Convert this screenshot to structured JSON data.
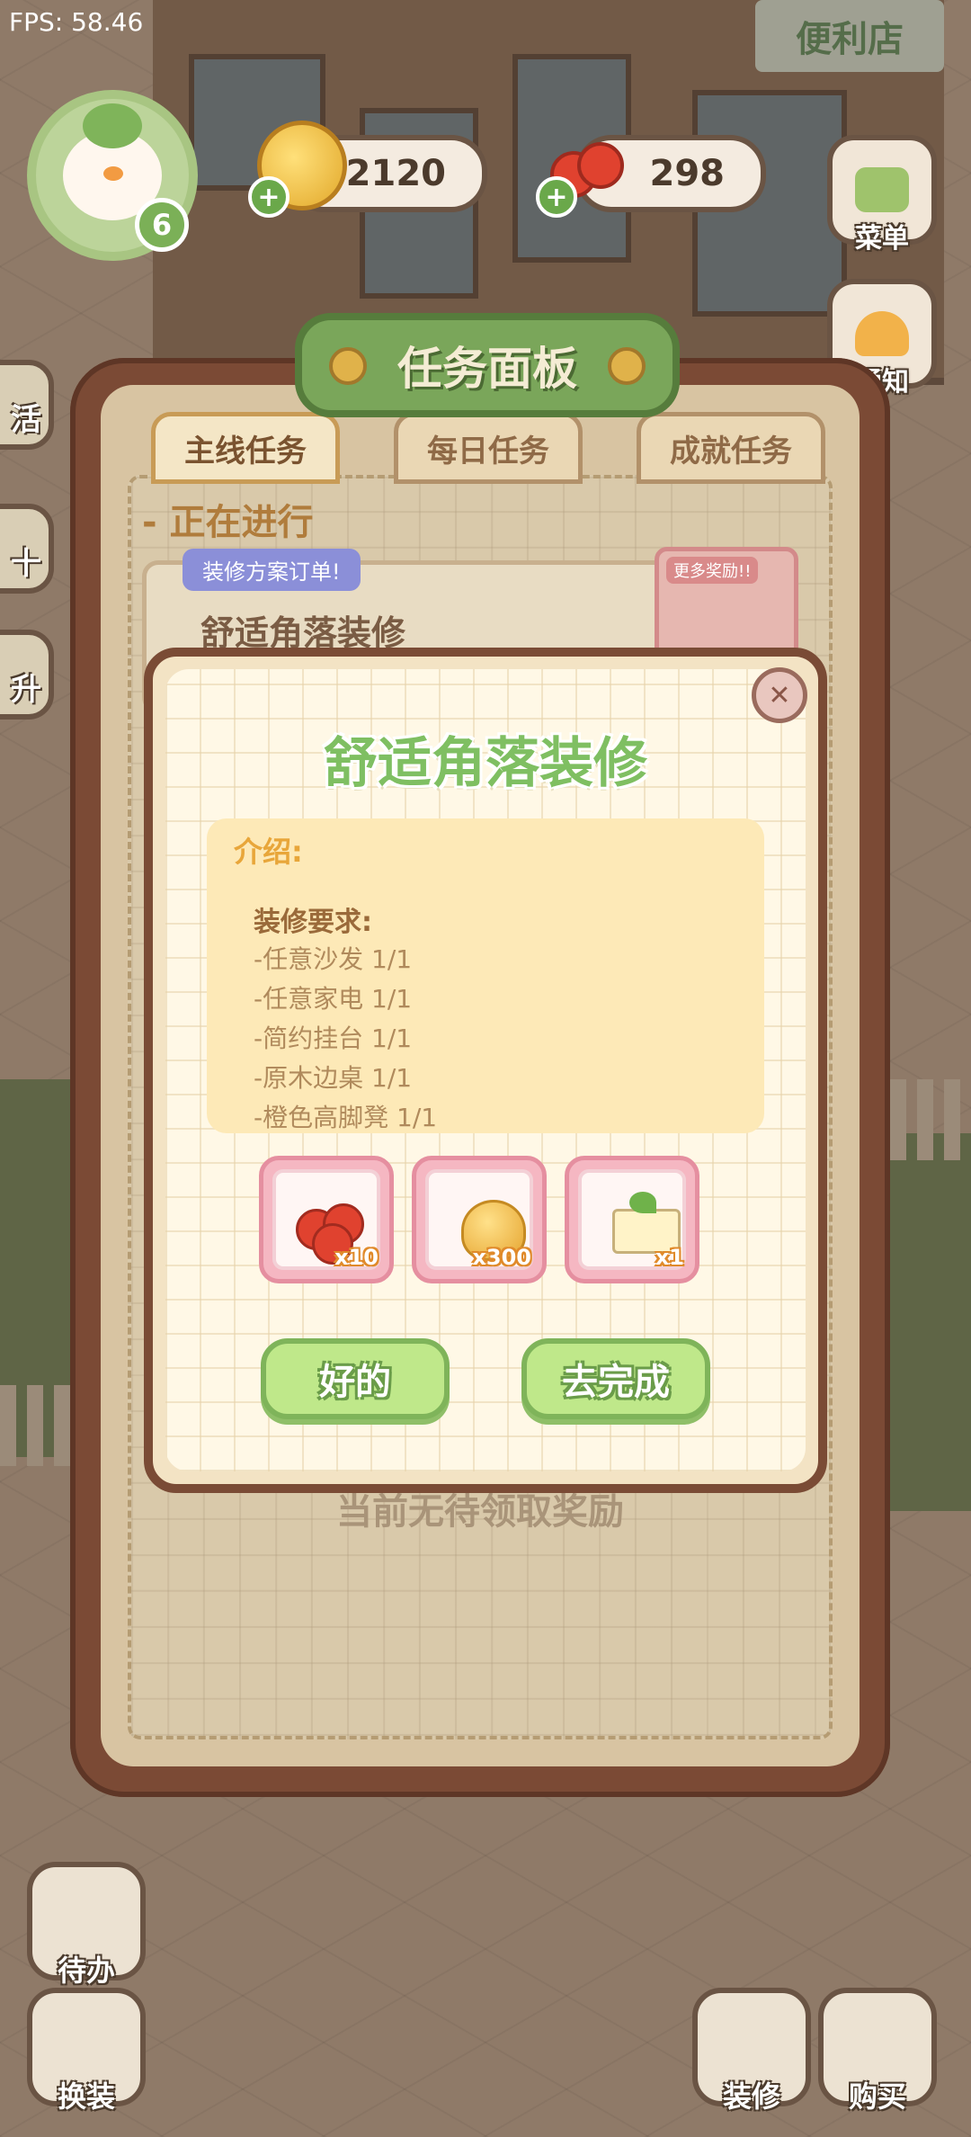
{
  "hud": {
    "fps": "FPS: 58.46",
    "level": "6",
    "coins": "2120",
    "cherries": "298",
    "menu_label": "菜单",
    "notify_label": "通知",
    "shop_sign": "便利店"
  },
  "left_partial": [
    "活",
    "十",
    "升"
  ],
  "task_board": {
    "title": "任务面板",
    "tabs": [
      "主线任务",
      "每日任务",
      "成就任务"
    ],
    "in_progress": "- 正在进行",
    "task_tag": "装修方案订单!",
    "task_name": "舒适角落装修",
    "more_reward": "更多奖励!!",
    "empty_text": "当前无待领取奖励"
  },
  "dialog": {
    "title": "舒适角落装修",
    "intro_label": "介绍:",
    "requirements_title": "装修要求:",
    "requirements": [
      "-任意沙发 1/1",
      "-任意家电 1/1",
      "-简约挂台 1/1",
      "-原木边桌 1/1",
      "-橙色高脚凳 1/1"
    ],
    "rewards": [
      {
        "icon": "cherry-icon",
        "qty": "x10"
      },
      {
        "icon": "gold-pile-icon",
        "qty": "x300"
      },
      {
        "icon": "seed-box-icon",
        "qty": "x1"
      }
    ],
    "ok_label": "好的",
    "go_label": "去完成"
  },
  "bottom": {
    "todo_label": "待办",
    "outfit_label": "换装",
    "decorate_label": "装修",
    "buy_label": "购买"
  },
  "colors": {
    "board_frame": "#7b4a35",
    "title_green": "#7fbf62",
    "button_green": "#bfe88a",
    "reward_pink": "#f5b7c2"
  }
}
